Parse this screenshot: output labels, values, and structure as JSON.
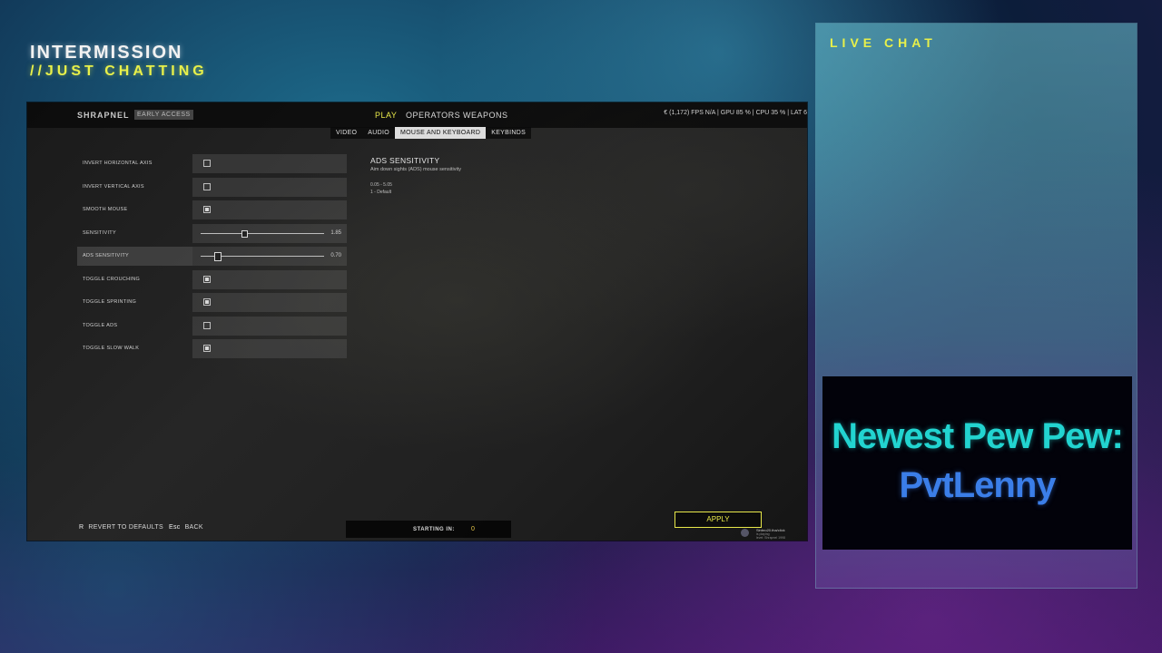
{
  "overlay": {
    "title": "INTERMISSION",
    "subtitle": "//JUST CHATTING"
  },
  "game": {
    "logo": "SHRAPNEL",
    "badge": "EARLY ACCESS",
    "nav": [
      {
        "label": "PLAY",
        "active": true
      },
      {
        "label": "OPERATORS",
        "active": false
      },
      {
        "label": "WEAPONS",
        "active": false
      }
    ],
    "stats": "€ (1,172)   FPS N/A  |  GPU 85 %  |  CPU 35 %  |  LAT 6",
    "subtabs": [
      {
        "label": "VIDEO",
        "active": false
      },
      {
        "label": "AUDIO",
        "active": false
      },
      {
        "label": "MOUSE AND KEYBOARD",
        "active": true
      },
      {
        "label": "KEYBINDS",
        "active": false
      }
    ],
    "settings": [
      {
        "label": "INVERT HORIZONTAL AXIS",
        "type": "checkbox",
        "checked": false
      },
      {
        "label": "INVERT VERTICAL AXIS",
        "type": "checkbox",
        "checked": false
      },
      {
        "label": "SMOOTH MOUSE",
        "type": "checkbox",
        "checked": true
      },
      {
        "label": "SENSITIVITY",
        "type": "slider",
        "value": "1.85",
        "fraction": 0.35
      },
      {
        "label": "ADS SENSITIVITY",
        "type": "slider",
        "value": "0.70",
        "fraction": 0.13,
        "selected": true
      },
      {
        "label": "TOGGLE CROUCHING",
        "type": "checkbox",
        "checked": true
      },
      {
        "label": "TOGGLE SPRINTING",
        "type": "checkbox",
        "checked": true
      },
      {
        "label": "TOGGLE ADS",
        "type": "checkbox",
        "checked": false
      },
      {
        "label": "TOGGLE SLOW WALK",
        "type": "checkbox",
        "checked": true
      }
    ],
    "description": {
      "title": "ADS SENSITIVITY",
      "subtitle": "Aim down sights (ADS) mouse sensitivity",
      "range": "0.05 - 5.05",
      "default": "1 - Default"
    },
    "footer": {
      "revert_key": "R",
      "revert_label": "REVERT TO DEFAULTS",
      "back_key": "Esc",
      "back_label": "BACK"
    },
    "starting": {
      "label": "STARTING IN:",
      "value": "0"
    },
    "apply_label": "APPLY",
    "webcam": {
      "name": "Sinbro20.tha/click",
      "line1": "is playing",
      "line2": "level: Shrapnel 1998"
    }
  },
  "chat": {
    "title": "LIVE CHAT"
  },
  "alert": {
    "line1": "Newest Pew Pew:",
    "line2": "PvtLenny"
  }
}
